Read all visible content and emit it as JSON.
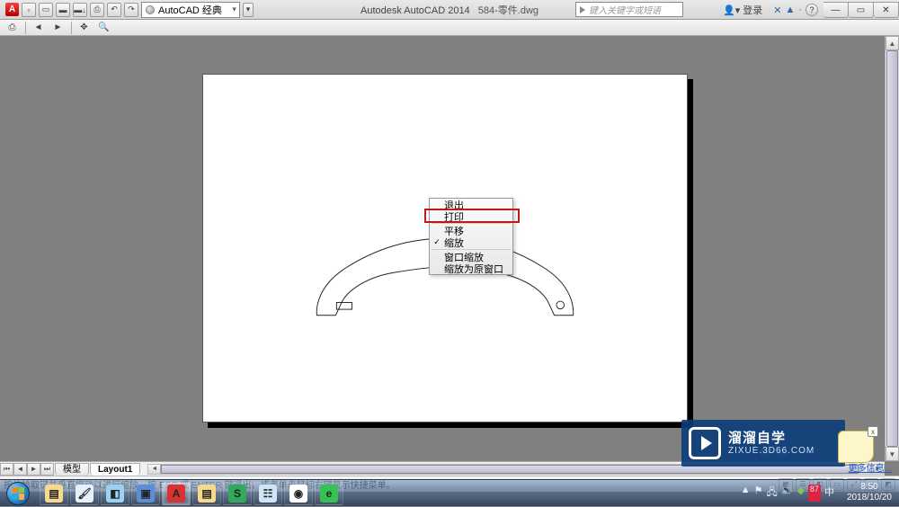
{
  "titlebar": {
    "workspace_label": "AutoCAD 经典",
    "app_name": "Autodesk AutoCAD 2014",
    "doc_name": "584-零件.dwg",
    "search_placeholder": "键入关键字或短语",
    "user_label": "登录",
    "qat": {
      "new": "▫",
      "open": "▭",
      "save": "▬",
      "saveas": "▬↓",
      "plot": "⎙",
      "undo": "↶",
      "redo": "↷"
    },
    "icons": {
      "infocenter": "✕",
      "exchange": "▲",
      "help": "?"
    },
    "winbtns": {
      "min": "—",
      "max": "▭",
      "close": "✕"
    }
  },
  "toolbar2": {
    "plot_preview": "⎙",
    "prev": "◄",
    "next": "►",
    "pan": "✥",
    "zoom": "🔍"
  },
  "context_menu": {
    "items": [
      {
        "key": "exit",
        "label": "退出",
        "checked": false,
        "highlight": false
      },
      {
        "key": "print",
        "label": "打印",
        "checked": false,
        "highlight": true
      },
      {
        "key": "pan",
        "label": "平移",
        "checked": false,
        "highlight": false
      },
      {
        "key": "zoom",
        "label": "缩放",
        "checked": true,
        "highlight": false
      },
      {
        "key": "zoom_window",
        "label": "窗口缩放",
        "checked": false,
        "highlight": false
      },
      {
        "key": "zoom_orig",
        "label": "缩放为原窗口",
        "checked": false,
        "highlight": false
      }
    ]
  },
  "layout_tabs": {
    "nav": {
      "first": "⏮",
      "prev": "◄",
      "next": "►",
      "last": "⏭"
    },
    "tabs": [
      {
        "name": "模型",
        "active": false
      },
      {
        "name": "Layout1",
        "active": true
      }
    ]
  },
  "statusbar": {
    "message": "按住拾取键并垂直拖动以进行缩放，按 ESC 或 ENTER 键退出，或者单击鼠标右键显示快捷菜单。"
  },
  "callout": {
    "text": "",
    "close": "x"
  },
  "morelink": "更多信息...",
  "watermark": {
    "line1": "溜溜自学",
    "line2": "ZIXUE.3D66.COM"
  },
  "taskbar": {
    "icons": [
      {
        "name": "explorer",
        "glyph": "▤",
        "color": "#f7d98c",
        "active": false
      },
      {
        "name": "paint",
        "glyph": "🖌",
        "color": "#e6f0fb",
        "active": false
      },
      {
        "name": "unknown1",
        "glyph": "◧",
        "color": "#9bd1f0",
        "active": false
      },
      {
        "name": "desktop",
        "glyph": "▣",
        "color": "#5a8fd6",
        "active": false
      },
      {
        "name": "autocad",
        "glyph": "A",
        "color": "#d83333",
        "active": true
      },
      {
        "name": "folder2",
        "glyph": "▤",
        "color": "#f7d98c",
        "active": false
      },
      {
        "name": "wps",
        "glyph": "S",
        "color": "#2faa5a",
        "active": false
      },
      {
        "name": "app-more",
        "glyph": "☷",
        "color": "#cfe4f7",
        "active": false
      },
      {
        "name": "qq",
        "glyph": "◉",
        "color": "#ffffff",
        "active": false
      },
      {
        "name": "360",
        "glyph": "e",
        "color": "#34c253",
        "active": false
      }
    ],
    "clock_time": "8:50",
    "clock_date": "2018/10/20"
  }
}
